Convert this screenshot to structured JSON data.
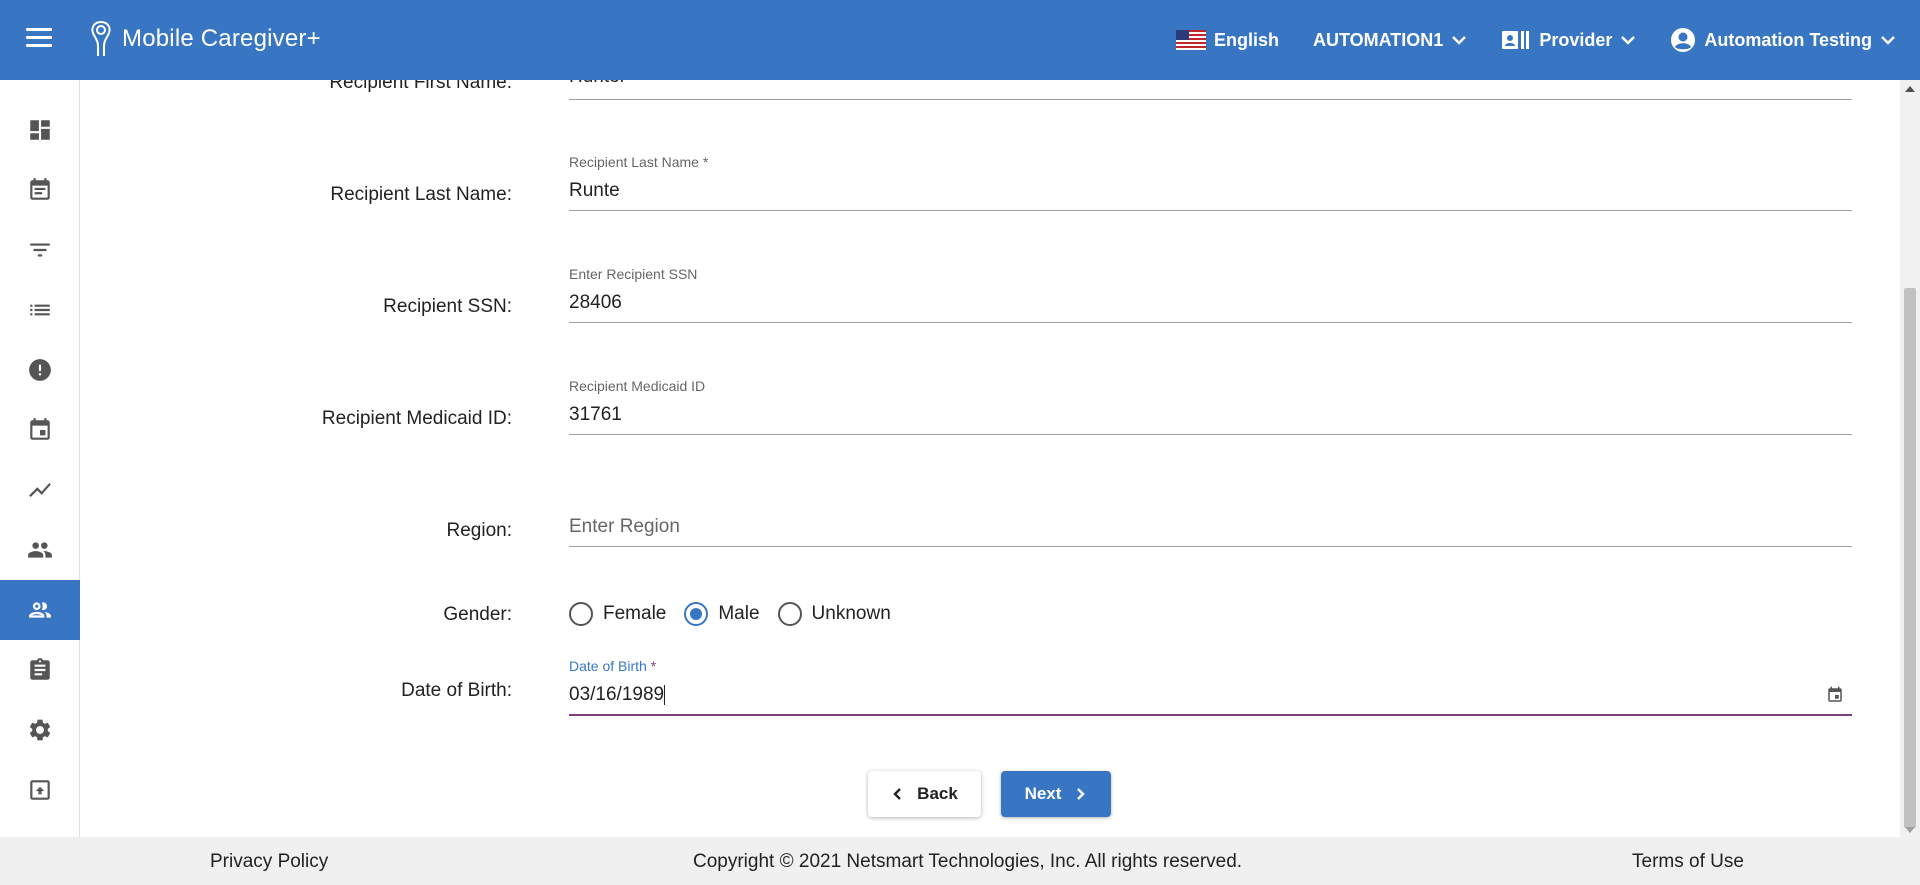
{
  "header": {
    "app_name": "Mobile Caregiver+",
    "language": "English",
    "organization": "AUTOMATION1",
    "role": "Provider",
    "user": "Automation Testing"
  },
  "sidebar": {
    "items": [
      {
        "icon": "dashboard-icon"
      },
      {
        "icon": "calendar-note-icon"
      },
      {
        "icon": "filter-icon"
      },
      {
        "icon": "list-icon"
      },
      {
        "icon": "alert-icon"
      },
      {
        "icon": "calendar-icon"
      },
      {
        "icon": "trend-icon"
      },
      {
        "icon": "people-icon"
      },
      {
        "icon": "recipients-icon",
        "active": true
      },
      {
        "icon": "clipboard-icon"
      },
      {
        "icon": "gear-icon"
      },
      {
        "icon": "upload-icon"
      }
    ]
  },
  "form": {
    "first_name": {
      "label": "Recipient First Name:",
      "value": "Hunter"
    },
    "last_name": {
      "label": "Recipient Last Name:",
      "float_label": "Recipient Last Name *",
      "value": "Runte"
    },
    "ssn": {
      "label": "Recipient SSN:",
      "float_label": "Enter Recipient SSN",
      "value": "28406"
    },
    "medicaid": {
      "label": "Recipient Medicaid ID:",
      "float_label": "Recipient Medicaid ID",
      "value": "31761"
    },
    "region": {
      "label": "Region:",
      "placeholder": "Enter Region"
    },
    "gender": {
      "label": "Gender:",
      "options": [
        "Female",
        "Male",
        "Unknown"
      ],
      "selected": "Male"
    },
    "dob": {
      "label": "Date of Birth:",
      "float_label": "Date of Birth",
      "required_mark": "*",
      "value": "03/16/1989"
    }
  },
  "buttons": {
    "back": "Back",
    "next": "Next"
  },
  "footer": {
    "privacy": "Privacy Policy",
    "copyright": "Copyright © 2021 Netsmart Technologies, Inc. All rights reserved.",
    "terms": "Terms of Use"
  },
  "colors": {
    "primary": "#3876c4",
    "focus_underline": "#7b3f7f"
  }
}
